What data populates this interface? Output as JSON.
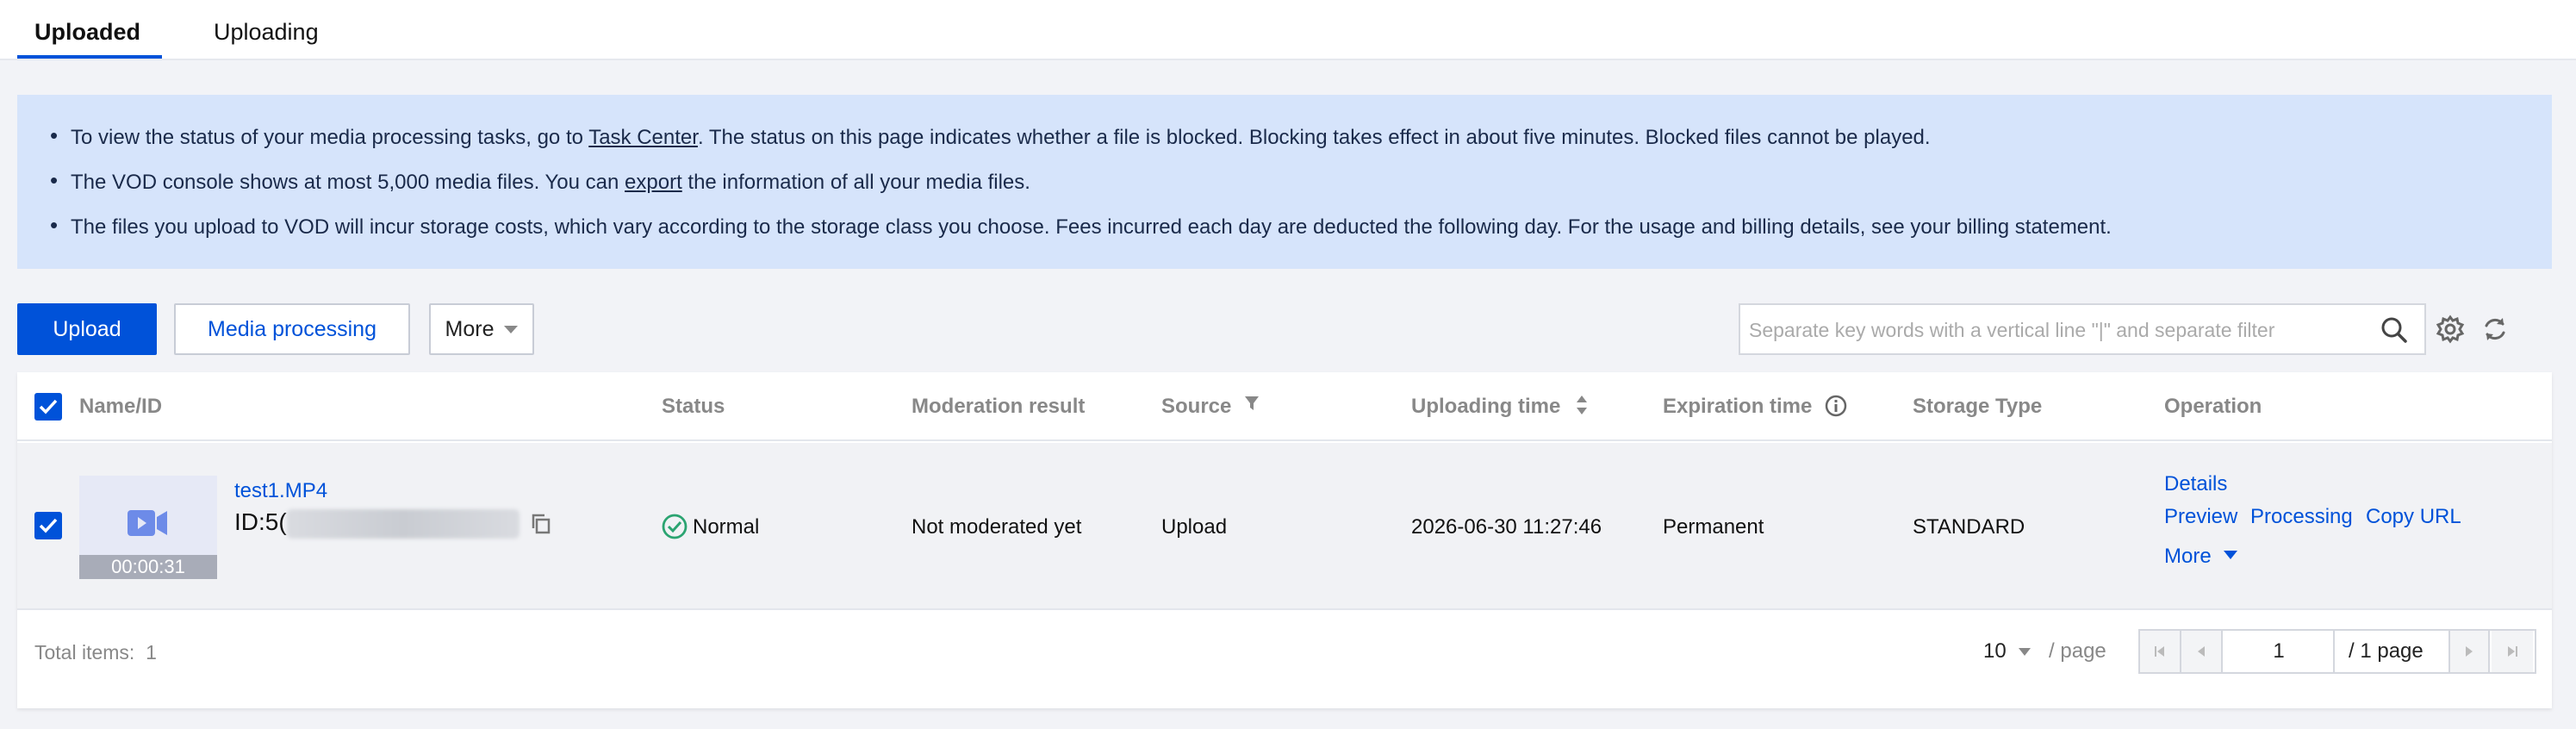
{
  "tabs": [
    {
      "label": "Uploaded",
      "active": true
    },
    {
      "label": "Uploading",
      "active": false
    }
  ],
  "notice": {
    "line1_pre": "To view the status of your media processing tasks, go to ",
    "line1_link": "Task Center",
    "line1_post": ". The status on this page indicates whether a file is blocked. Blocking takes effect in about five minutes. Blocked files cannot be played.",
    "line2_pre": "The VOD console shows at most 5,000 media files. You can ",
    "line2_link": "export",
    "line2_post": " the information of all your media files.",
    "line3": "The files you upload to VOD will incur storage costs, which vary according to the storage class you choose. Fees incurred each day are deducted the following day. For the usage and billing details, see your billing statement."
  },
  "toolbar": {
    "upload_label": "Upload",
    "media_processing_label": "Media processing",
    "more_label": "More",
    "search_placeholder": "Separate key words with a vertical line \"|\" and separate filter"
  },
  "table": {
    "headers": {
      "name": "Name/ID",
      "status": "Status",
      "moderation": "Moderation result",
      "source": "Source",
      "uploading_time": "Uploading time",
      "expiration": "Expiration time",
      "storage": "Storage Type",
      "operation": "Operation"
    },
    "rows": [
      {
        "checked": true,
        "name": "test1.MP4",
        "id_prefix": "ID:5(",
        "duration": "00:00:31",
        "status": "Normal",
        "moderation": "Not moderated yet",
        "source": "Upload",
        "uploading_time": "2026-06-30 11:27:46",
        "expiration": "Permanent",
        "storage": "STANDARD",
        "ops": {
          "details": "Details",
          "preview": "Preview",
          "processing": "Processing",
          "copy_url": "Copy URL",
          "more": "More"
        }
      }
    ]
  },
  "footer": {
    "total_label": "Total items:",
    "total_value": "1",
    "page_size": "10",
    "page_size_unit": "/ page",
    "current_page": "1",
    "total_pages": "/ 1 page"
  },
  "colors": {
    "accent": "#0052d9",
    "notice_bg": "#d6e4fb",
    "status_ok": "#2ba471"
  },
  "icons": [
    "search-icon",
    "gear-icon",
    "refresh-icon",
    "filter-icon",
    "sort-icon",
    "info-icon",
    "copy-icon",
    "video-icon",
    "check-circle-icon",
    "chevron-down-icon",
    "first-page-icon",
    "prev-page-icon",
    "next-page-icon",
    "last-page-icon"
  ]
}
